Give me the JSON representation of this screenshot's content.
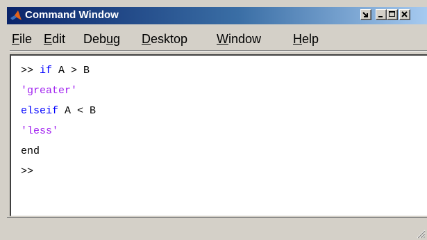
{
  "window": {
    "title": "Command Window",
    "icon": "matlab-logo-icon",
    "titlebar_gradient": [
      "#0a246a",
      "#a6caf0"
    ],
    "buttons": [
      "undock-icon",
      "minimize-icon",
      "maximize-icon",
      "close-icon"
    ]
  },
  "menu": {
    "items": [
      {
        "label_ul": "F",
        "label_rest": "ile"
      },
      {
        "label_ul": "E",
        "label_rest": "dit"
      },
      {
        "label_pre": "Deb",
        "label_ul": "u",
        "label_rest": "g"
      },
      {
        "label_ul": "D",
        "label_rest": "esktop"
      },
      {
        "label_ul": "W",
        "label_rest": "indow"
      },
      {
        "label_ul": "H",
        "label_rest": "elp"
      }
    ]
  },
  "console": {
    "colors": {
      "keyword": "#0000ff",
      "string": "#a020f0",
      "text": "#000000"
    },
    "lines": [
      {
        "prompt": ">> ",
        "keyword": "if",
        "rest": " A > B"
      },
      {
        "string": "'greater'"
      },
      {
        "keyword": "elseif",
        "rest": " A < B"
      },
      {
        "string": "'less'"
      },
      {
        "text": "end"
      },
      {
        "prompt": ">>"
      }
    ]
  }
}
